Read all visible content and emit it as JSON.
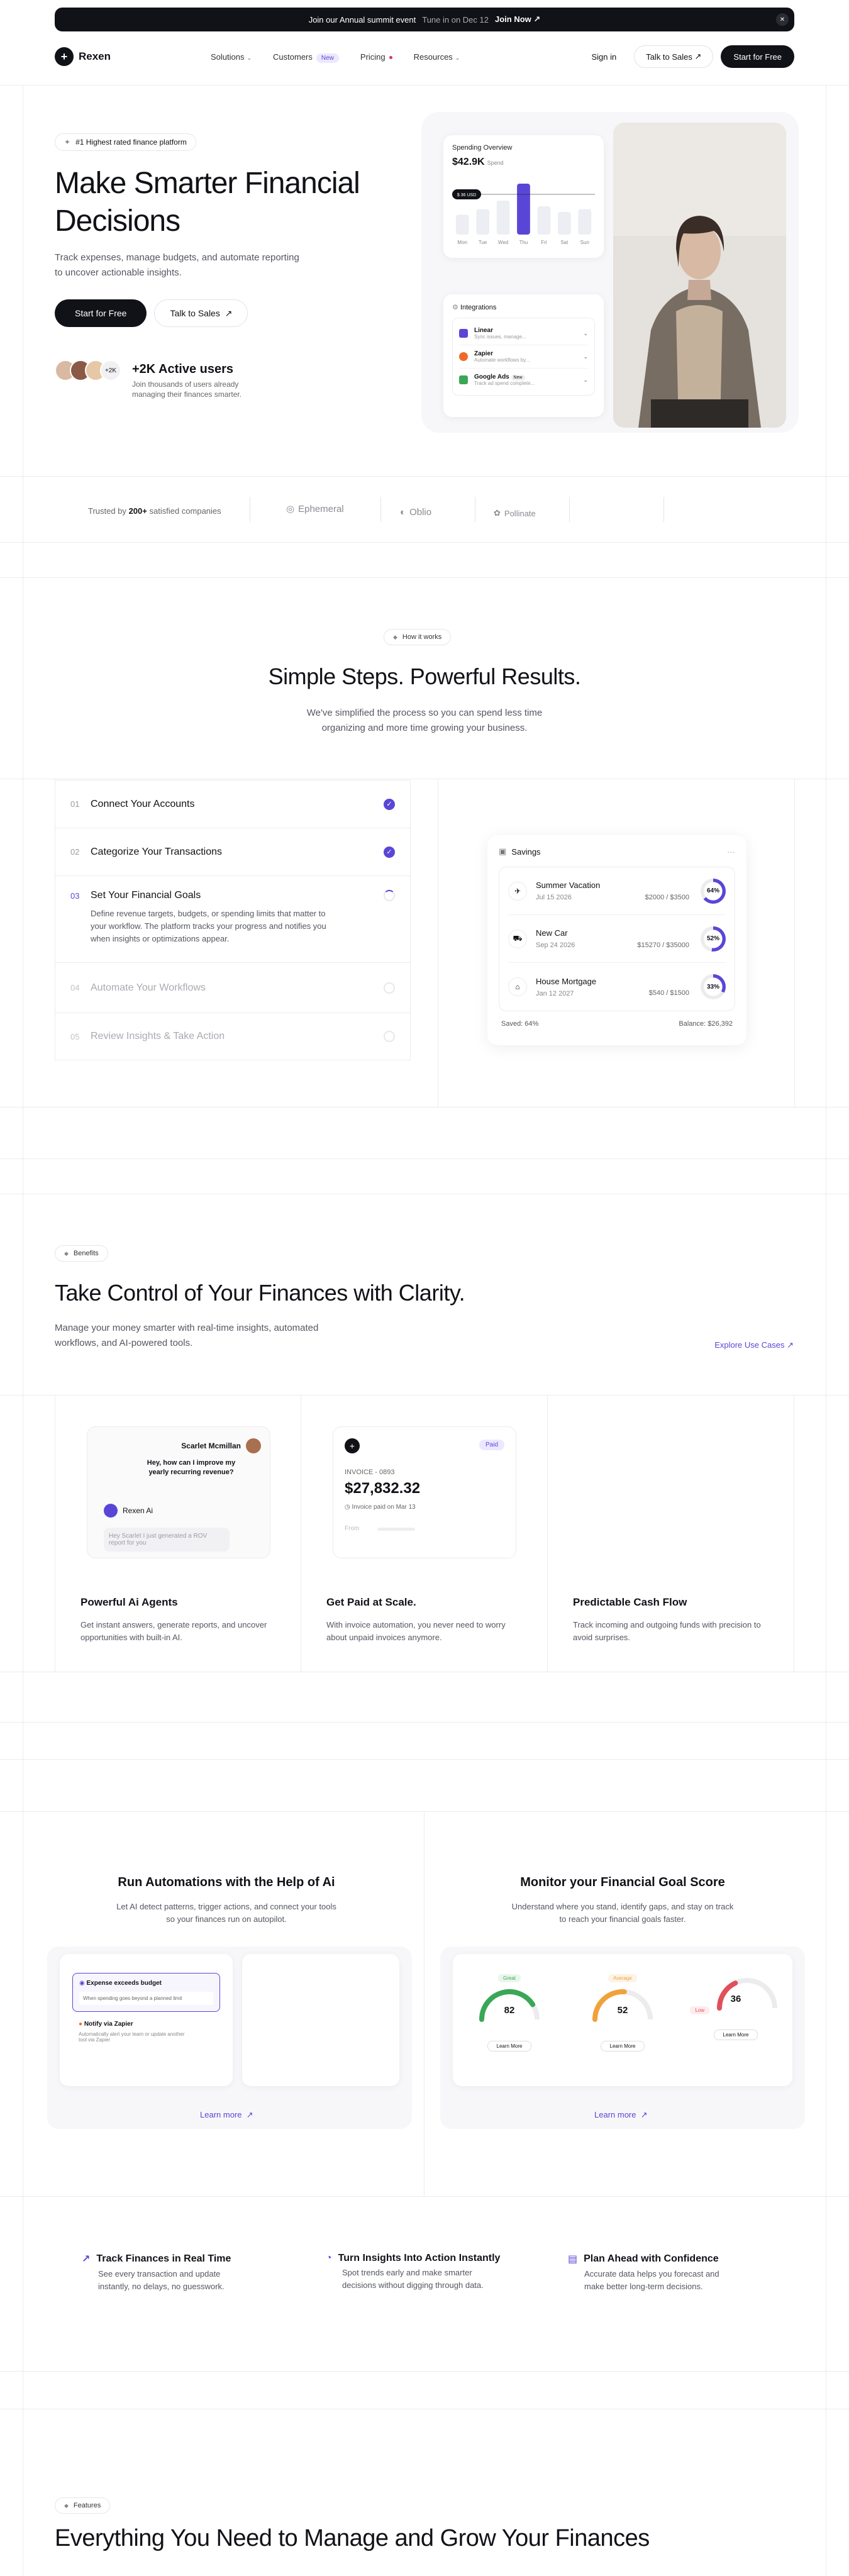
{
  "announcement": {
    "text": "Join our Annual summit event",
    "subtext": "Tune in on Dec 12",
    "cta": "Join Now",
    "close_icon": "close-icon"
  },
  "nav": {
    "brand": "Rexen",
    "links": [
      "Solutions",
      "Customers",
      "Pricing",
      "Resources"
    ],
    "new_badge": "New",
    "signin": "Sign in",
    "talk": "Talk to Sales",
    "start": "Start for Free"
  },
  "hero": {
    "pill": "#1 Highest rated finance platform",
    "title": "Make Smarter Financial Decisions",
    "subtitle": "Track expenses, manage budgets, and automate reporting to uncover actionable insights.",
    "cta_primary": "Start for Free",
    "cta_secondary": "Talk to Sales",
    "avatar_count": "+2K",
    "users_title": "+2K Active users",
    "users_sub": "Join thousands of users already managing their finances smarter.",
    "spending": {
      "label": "Spending Overview",
      "amount": "$42.9K",
      "amount_note": "Spend",
      "tooltip": "$ 36 USD",
      "days": [
        "Mon",
        "Tue",
        "Wed",
        "Thu",
        "Fri",
        "Sat",
        "Sun"
      ],
      "values": [
        0.35,
        0.45,
        0.6,
        0.9,
        0.5,
        0.4,
        0.45
      ]
    },
    "integrations": {
      "label": "Integrations",
      "items": [
        {
          "name": "Linear",
          "desc": "Sync issues, manage...",
          "color": "#5a46d6"
        },
        {
          "name": "Zapier",
          "desc": "Automate workflows by...",
          "color": "#f06a25"
        },
        {
          "name": "Google Ads",
          "desc": "Track ad spend complete...",
          "color": "#3aa757",
          "badge": "New"
        }
      ]
    }
  },
  "trusted": {
    "prefix": "Trusted by",
    "count": "200+",
    "suffix": "satisfied companies",
    "logos": [
      "Ephemeral",
      "Oblio",
      "Pollinate"
    ]
  },
  "how": {
    "pill": "How it works",
    "title": "Simple Steps. Powerful Results.",
    "subtitle": "We've simplified the process so you can spend less time organizing and more time growing your business.",
    "steps": [
      {
        "num": "01",
        "label": "Connect Your Accounts"
      },
      {
        "num": "02",
        "label": "Categorize Your Transactions"
      },
      {
        "num": "03",
        "label": "Set Your Financial Goals",
        "desc": "Define revenue targets, budgets, or spending limits that matter to your workflow. The platform tracks your progress and notifies you when insights or optimizations appear."
      },
      {
        "num": "04",
        "label": "Automate Your Workflows"
      },
      {
        "num": "05",
        "label": "Review Insights & Take Action"
      }
    ],
    "savings": {
      "label": "Savings",
      "rows": [
        {
          "name": "Summer Vacation",
          "date": "Jul 15 2026",
          "amount": "$2000 / $3500",
          "pct": "64%",
          "pct_value": 64
        },
        {
          "name": "New Car",
          "date": "Sep 24 2026",
          "amount": "$15270 / $35000",
          "pct": "52%",
          "pct_value": 52
        },
        {
          "name": "House Mortgage",
          "date": "Jan 12 2027",
          "amount": "$540 / $1500",
          "pct": "33%",
          "pct_value": 33
        }
      ],
      "saved": "Saved: 64%",
      "balance": "Balance: $26,392"
    }
  },
  "benefits": {
    "pill": "Benefits",
    "title": "Take Control of Your Finances with Clarity.",
    "subtitle": "Manage your money smarter with real-time insights, automated workflows, and AI-powered tools.",
    "explore": "Explore Use Cases",
    "cards": [
      {
        "title": "Powerful Ai Agents",
        "desc": "Get instant answers, generate reports, and uncover opportunities with built-in AI."
      },
      {
        "title": "Get Paid at Scale.",
        "desc": "With invoice automation, you never need to worry about unpaid invoices anymore."
      },
      {
        "title": "Predictable Cash Flow",
        "desc": "Track incoming and outgoing funds with precision to avoid surprises."
      }
    ],
    "chat": {
      "user": "Scarlet Mcmillan",
      "question": "Hey, how can I improve my yearly recurring revenue?",
      "bot": "Rexen Ai",
      "reply": "Hey Scarlet I just generated a ROV report for you"
    },
    "invoice": {
      "id": "INVOICE - 0893",
      "status": "Paid",
      "amount": "$27,832.32",
      "note": "Invoice paid on Mar 13",
      "from": "From"
    }
  },
  "automation": {
    "title": "Run Automations with the Help of Ai",
    "subtitle": "Let AI detect patterns, trigger actions, and connect your tools so your finances run on autopilot.",
    "trigger": "Expense exceeds budget",
    "trigger_desc": "When spending goes beyond a planned limit",
    "action": "Notify via Zapier",
    "action_desc": "Automatically alert your team or update another tool via Zapier",
    "learn": "Learn more"
  },
  "goal": {
    "title": "Monitor your Financial Goal Score",
    "subtitle": "Understand where you stand, identify gaps, and stay on track to reach your financial goals faster.",
    "scores": [
      {
        "tag": "Great",
        "score": "82",
        "value": 82,
        "color": "#3aa757"
      },
      {
        "tag": "Average",
        "score": "52",
        "value": 52,
        "color": "#f0a23a"
      },
      {
        "tag": "Low",
        "score": "36",
        "value": 36,
        "color": "#e0505b"
      }
    ],
    "card_button": "Learn More",
    "learn": "Learn more"
  },
  "features_row": [
    {
      "title": "Track Finances in Real Time",
      "desc": "See every transaction and update instantly, no delays, no guesswork."
    },
    {
      "title": "Turn Insights Into Action Instantly",
      "desc": "Spot trends early and make smarter decisions without digging through data."
    },
    {
      "title": "Plan Ahead with Confidence",
      "desc": "Accurate data helps you forecast and make better long-term decisions."
    }
  ],
  "features": {
    "pill": "Features",
    "title": "Everything You Need to Manage and Grow Your Finances"
  },
  "colors": {
    "accent": "#5a46d6",
    "dark": "#111217"
  }
}
